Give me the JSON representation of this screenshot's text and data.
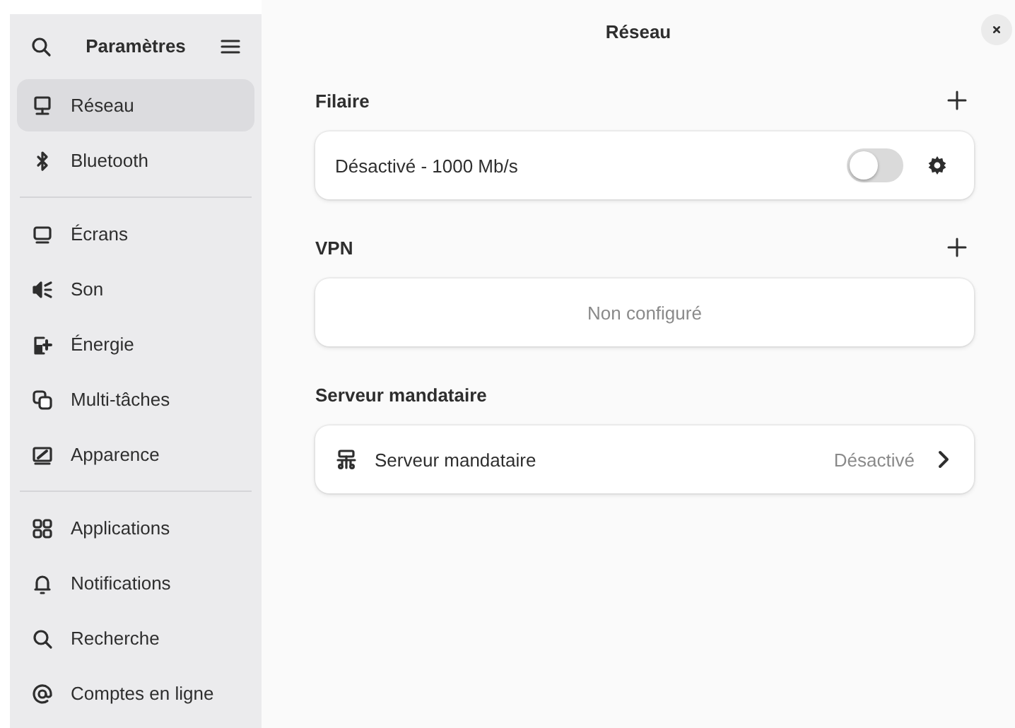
{
  "sidebar": {
    "title": "Paramètres",
    "groups": [
      [
        {
          "label": "Réseau",
          "kind": "network",
          "selected": true
        },
        {
          "label": "Bluetooth",
          "kind": "bluetooth",
          "selected": false
        }
      ],
      [
        {
          "label": "Écrans",
          "kind": "display",
          "selected": false
        },
        {
          "label": "Son",
          "kind": "sound",
          "selected": false
        },
        {
          "label": "Énergie",
          "kind": "power",
          "selected": false
        },
        {
          "label": "Multi-tâches",
          "kind": "multitask",
          "selected": false
        },
        {
          "label": "Apparence",
          "kind": "appearance",
          "selected": false
        }
      ],
      [
        {
          "label": "Applications",
          "kind": "apps",
          "selected": false
        },
        {
          "label": "Notifications",
          "kind": "bell",
          "selected": false
        },
        {
          "label": "Recherche",
          "kind": "search",
          "selected": false
        },
        {
          "label": "Comptes en ligne",
          "kind": "at",
          "selected": false
        }
      ]
    ]
  },
  "main": {
    "title": "Réseau",
    "sections": [
      {
        "heading": "Filaire",
        "add": true,
        "rows": [
          {
            "kind": "switch",
            "label": "Désactivé - 1000 Mb/s",
            "on": false
          }
        ]
      },
      {
        "heading": "VPN",
        "add": true,
        "rows": [
          {
            "kind": "empty",
            "label": "Non configuré"
          }
        ]
      },
      {
        "heading": "Serveur mandataire",
        "add": false,
        "rows": [
          {
            "kind": "link",
            "label": "Serveur mandataire",
            "value": "Désactivé"
          }
        ]
      }
    ]
  }
}
